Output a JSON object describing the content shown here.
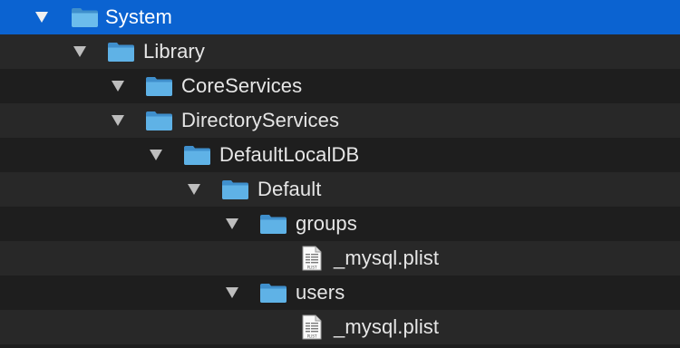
{
  "file_tree": {
    "rows": [
      {
        "label": "System",
        "kind": "folder",
        "level": 0,
        "expanded": true,
        "selected": true
      },
      {
        "label": "Library",
        "kind": "folder",
        "level": 1,
        "expanded": true,
        "selected": false
      },
      {
        "label": "CoreServices",
        "kind": "folder",
        "level": 2,
        "expanded": true,
        "selected": false
      },
      {
        "label": "DirectoryServices",
        "kind": "folder",
        "level": 2,
        "expanded": true,
        "selected": false
      },
      {
        "label": "DefaultLocalDB",
        "kind": "folder",
        "level": 3,
        "expanded": true,
        "selected": false
      },
      {
        "label": "Default",
        "kind": "folder",
        "level": 4,
        "expanded": true,
        "selected": false
      },
      {
        "label": "groups",
        "kind": "folder",
        "level": 5,
        "expanded": true,
        "selected": false
      },
      {
        "label": "_mysql.plist",
        "kind": "file",
        "level": 6,
        "expanded": false,
        "selected": false
      },
      {
        "label": "users",
        "kind": "folder",
        "level": 5,
        "expanded": true,
        "selected": false
      },
      {
        "label": "_mysql.plist",
        "kind": "file",
        "level": 6,
        "expanded": false,
        "selected": false
      }
    ]
  },
  "icons": {
    "folder": "folder-icon",
    "file": "plist-file-icon",
    "disclosure": "disclosure-triangle-icon"
  },
  "file_icon_caption": "PLIST",
  "colors": {
    "background": "#1e1e1e",
    "alternate_row": "#282828",
    "selection": "#0b63d1",
    "text": "#e6e6e6",
    "folder_blue": "#5fb2e6"
  }
}
